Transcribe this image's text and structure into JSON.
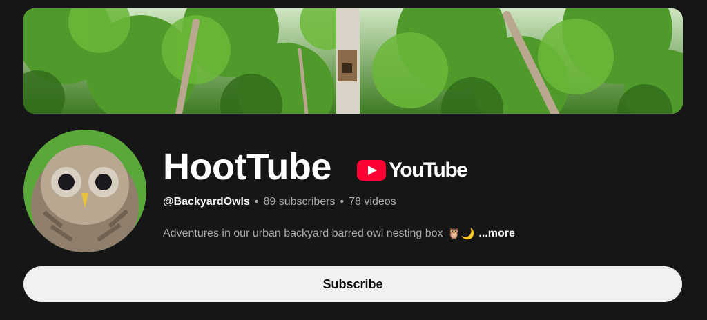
{
  "banner": {
    "image": "forest-canopy-with-owl-nesting-box"
  },
  "avatar": {
    "image": "barred-owl-portrait"
  },
  "channel": {
    "name": "HootTube",
    "logo_text": "YouTube",
    "handle": "@BackyardOwls",
    "separator": "•",
    "subscribers": "89 subscribers",
    "videos": "78 videos",
    "description": "Adventures in our urban backyard barred owl nesting box",
    "description_emoji": "🦉🌙",
    "more_label": "...more"
  },
  "subscribe_label": "Subscribe",
  "colors": {
    "background": "#161616",
    "youtube_red": "#ff0033",
    "button_bg": "#f1f1f1"
  }
}
